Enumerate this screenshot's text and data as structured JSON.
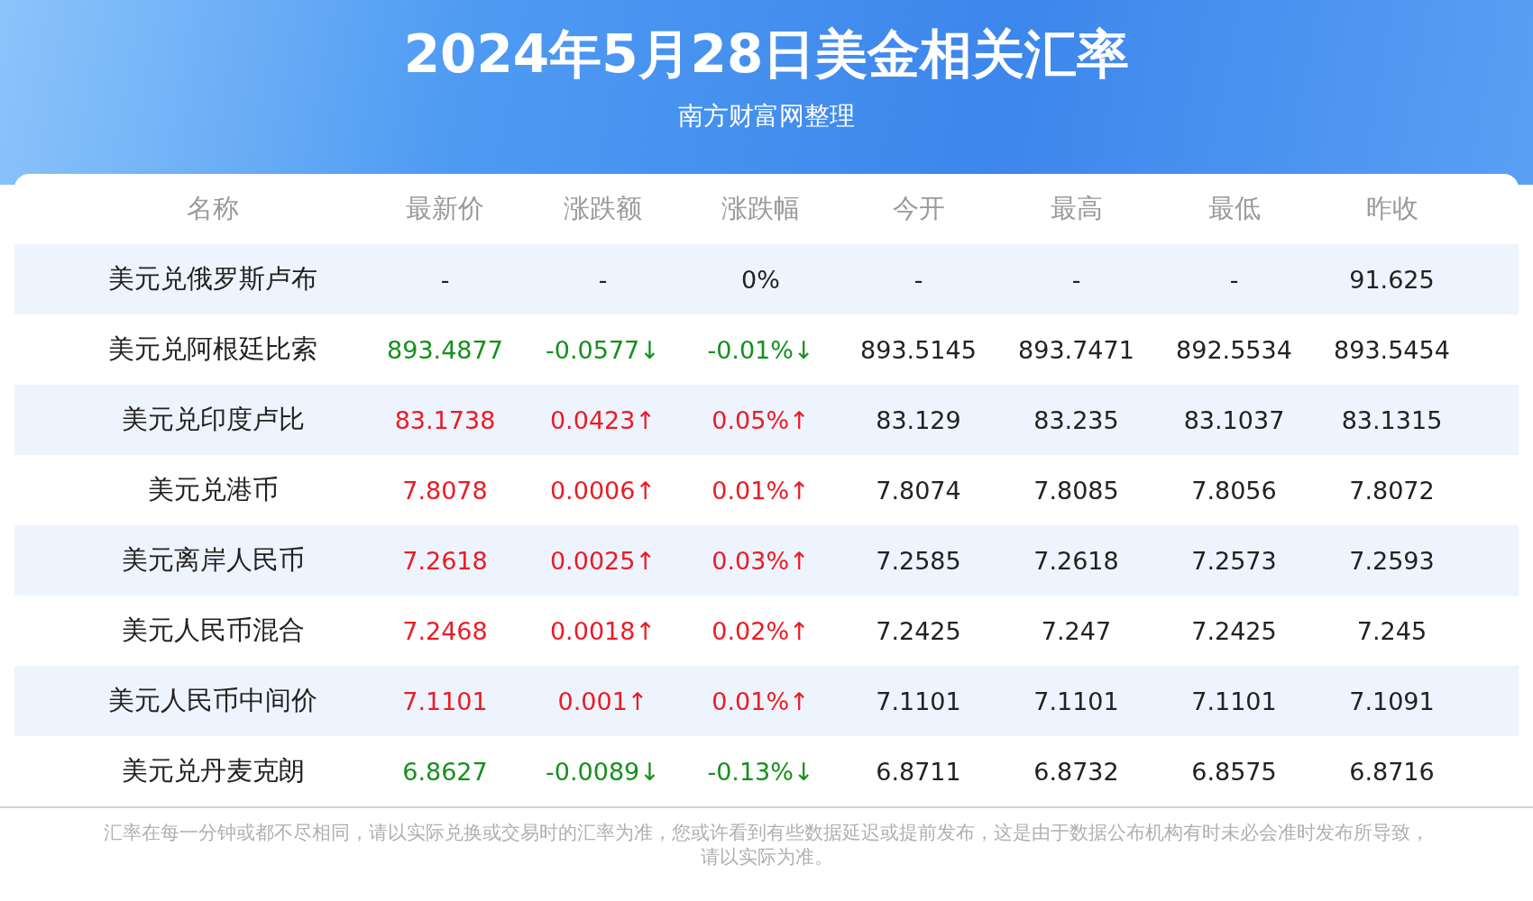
{
  "title": "2024年5月28日美金相关汇率",
  "subtitle": "南方财富网整理",
  "table": {
    "columns": [
      "名称",
      "最新价",
      "涨跌额",
      "涨跌幅",
      "今开",
      "最高",
      "最低",
      "昨收"
    ],
    "rows": [
      {
        "color": "#222222",
        "cells": [
          "美元兑俄罗斯卢布",
          "-",
          "-",
          "0%",
          "-",
          "-",
          "-",
          "91.625"
        ]
      },
      {
        "color": "#15901c",
        "cells": [
          "美元兑阿根廷比索",
          "893.4877",
          "-0.0577↓",
          "-0.01%↓",
          "893.5145",
          "893.7471",
          "892.5534",
          "893.5454"
        ]
      },
      {
        "color": "#ec1b24",
        "cells": [
          "美元兑印度卢比",
          "83.1738",
          "0.0423↑",
          "0.05%↑",
          "83.129",
          "83.235",
          "83.1037",
          "83.1315"
        ]
      },
      {
        "color": "#ec1b24",
        "cells": [
          "美元兑港币",
          "7.8078",
          "0.0006↑",
          "0.01%↑",
          "7.8074",
          "7.8085",
          "7.8056",
          "7.8072"
        ]
      },
      {
        "color": "#ec1b24",
        "cells": [
          "美元离岸人民币",
          "7.2618",
          "0.0025↑",
          "0.03%↑",
          "7.2585",
          "7.2618",
          "7.2573",
          "7.2593"
        ]
      },
      {
        "color": "#ec1b24",
        "cells": [
          "美元人民币混合",
          "7.2468",
          "0.0018↑",
          "0.02%↑",
          "7.2425",
          "7.247",
          "7.2425",
          "7.245"
        ]
      },
      {
        "color": "#ec1b24",
        "cells": [
          "美元人民币中间价",
          "7.1101",
          "0.001↑",
          "0.01%↑",
          "7.1101",
          "7.1101",
          "7.1101",
          "7.1091"
        ]
      },
      {
        "color": "#15901c",
        "cells": [
          "美元兑丹麦克朗",
          "6.8627",
          "-0.0089↓",
          "-0.13%↓",
          "6.8711",
          "6.8732",
          "6.8575",
          "6.8716"
        ]
      }
    ]
  },
  "footnote": "汇率在每一分钟或都不尽相同，请以实际兑换或交易时的汇率为准，您或许看到有些数据延迟或提前发布，这是由于数据公布机构有时未必会准时发布所导致，请以实际为准。"
}
